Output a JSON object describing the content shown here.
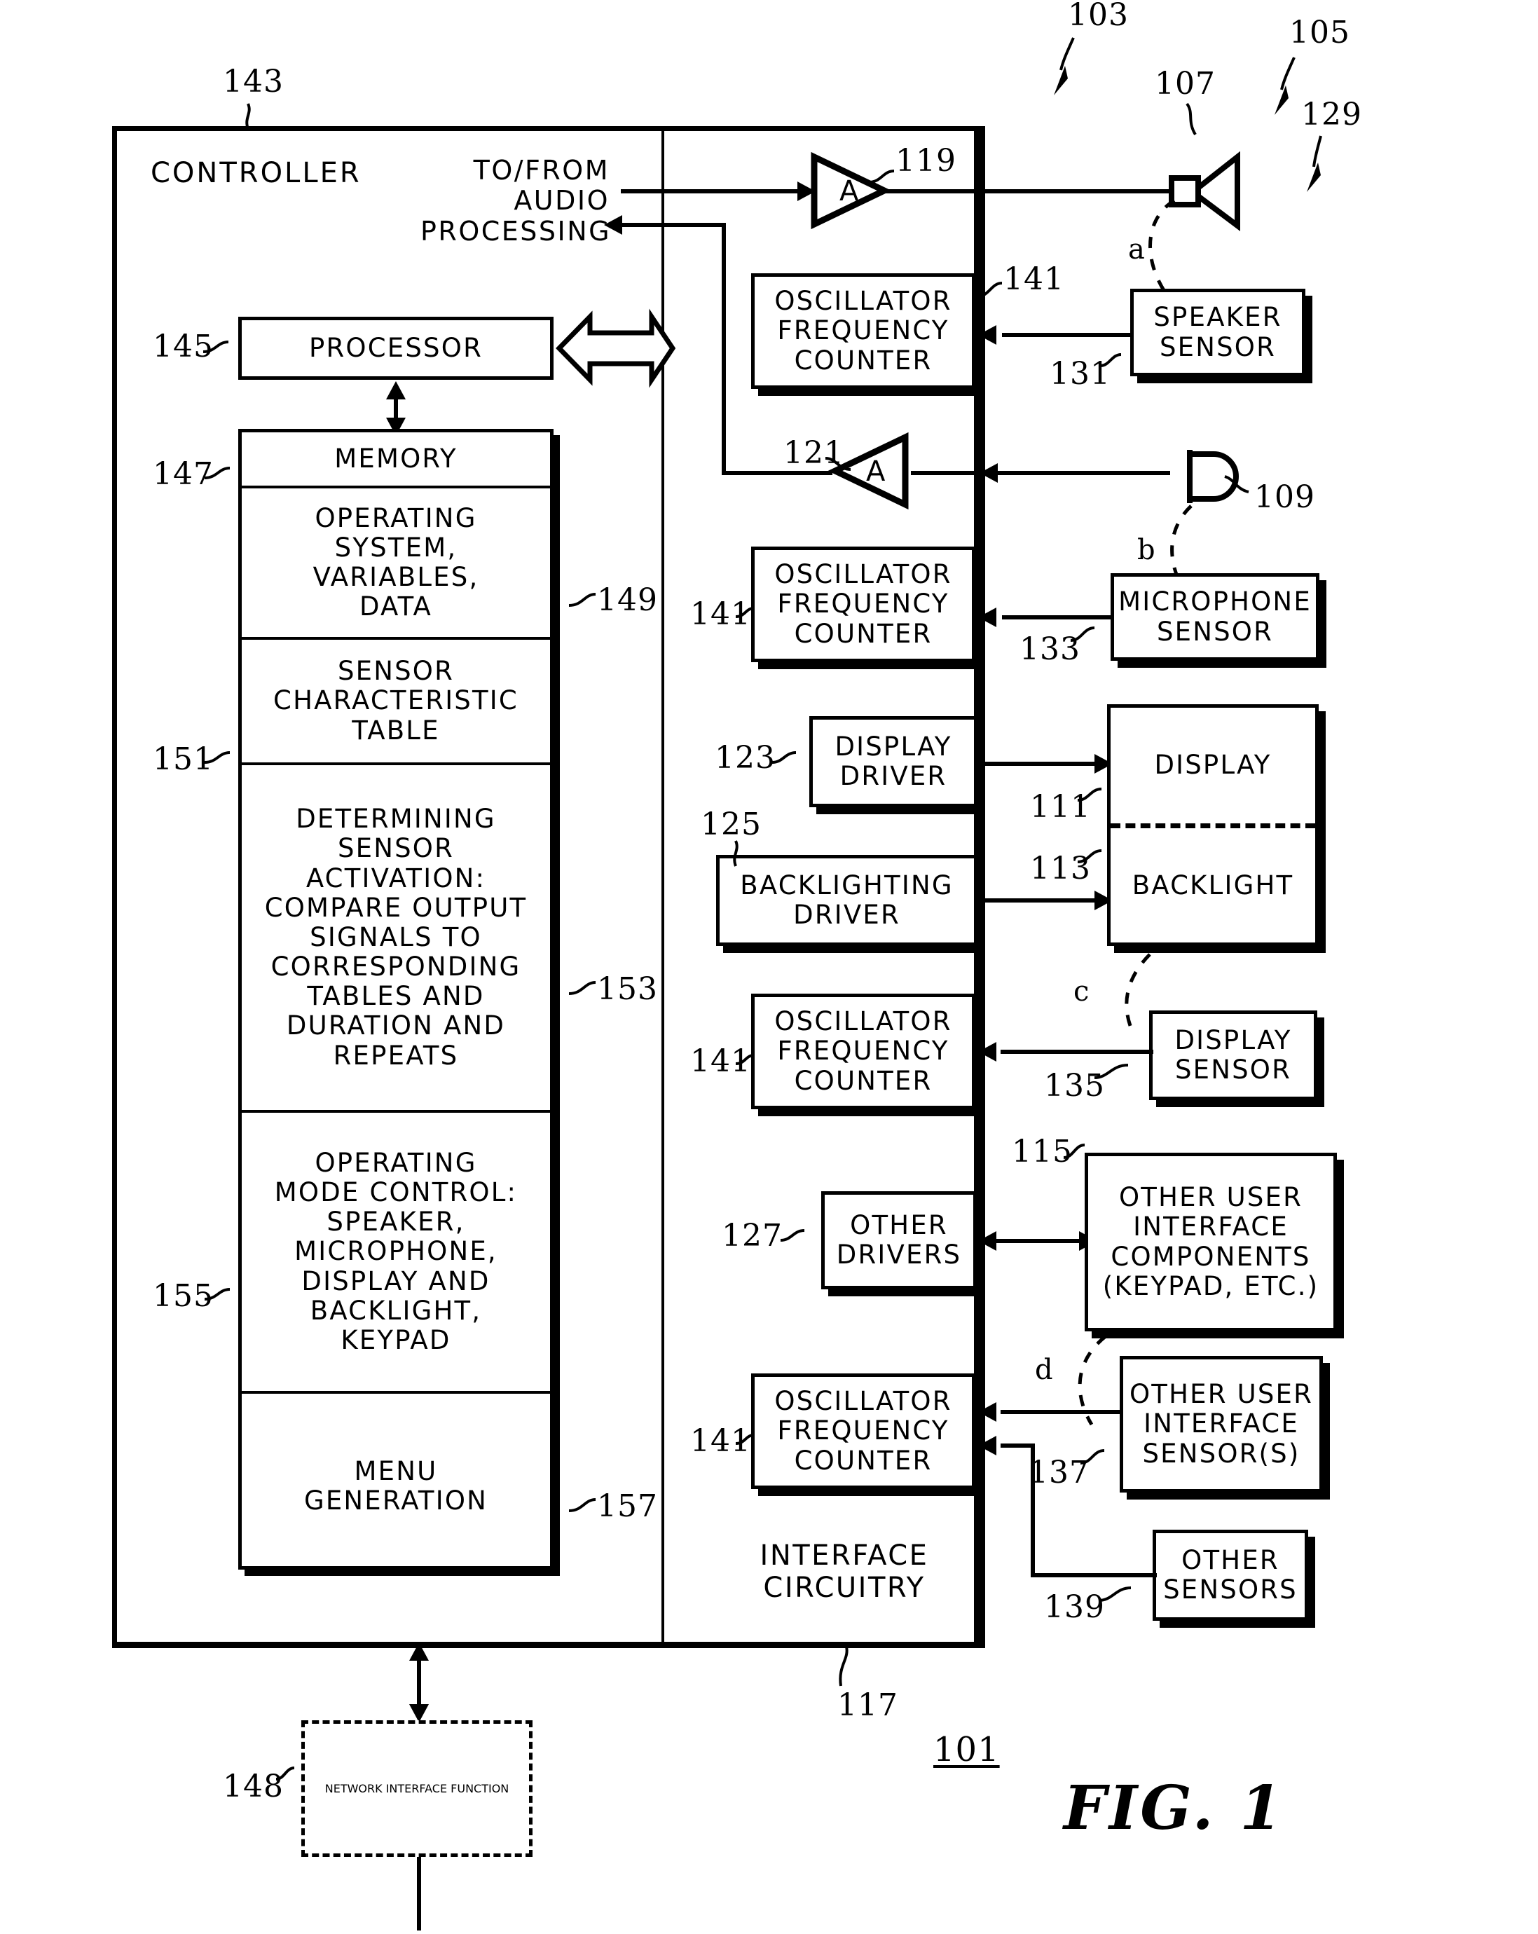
{
  "figure": {
    "title": "FIG. 1",
    "system_ref": "101"
  },
  "controller": {
    "title": "CONTROLLER",
    "ref": "143",
    "audio_label": "TO/FROM\nAUDIO\nPROCESSING",
    "processor": {
      "label": "PROCESSOR",
      "ref": "145"
    },
    "memory": {
      "title": "MEMORY",
      "ref": "147",
      "sections": [
        {
          "label": "OPERATING\nSYSTEM,\nVARIABLES,\nDATA",
          "ref": "149"
        },
        {
          "label": "SENSOR\nCHARACTERISTIC\nTABLE",
          "ref": "151"
        },
        {
          "label": "DETERMINING\nSENSOR\nACTIVATION:\nCOMPARE  OUTPUT\nSIGNALS  TO\nCORRESPONDING\nTABLES  AND\nDURATION  AND\nREPEATS",
          "ref": "153"
        },
        {
          "label": "OPERATING\nMODE CONTROL:\nSPEAKER,\nMICROPHONE,\nDISPLAY  AND\nBACKLIGHT,\nKEYPAD",
          "ref": "155"
        },
        {
          "label": "MENU\nGENERATION",
          "ref": "157"
        }
      ]
    }
  },
  "interface_circuitry": {
    "title": "INTERFACE\nCIRCUITRY",
    "ref": "117",
    "amplifiers": [
      {
        "label": "A",
        "ref": "119",
        "name": "speaker-amplifier"
      },
      {
        "label": "A",
        "ref": "121",
        "name": "microphone-amplifier"
      }
    ],
    "counters": [
      {
        "label": "OSCILLATOR\nFREQUENCY\nCOUNTER",
        "ref": "141"
      },
      {
        "label": "OSCILLATOR\nFREQUENCY\nCOUNTER",
        "ref": "141"
      },
      {
        "label": "OSCILLATOR\nFREQUENCY\nCOUNTER",
        "ref": "141"
      },
      {
        "label": "OSCILLATOR\nFREQUENCY\nCOUNTER",
        "ref": "141"
      }
    ],
    "drivers": [
      {
        "label": "DISPLAY\nDRIVER",
        "ref": "123"
      },
      {
        "label": "BACKLIGHTING\nDRIVER",
        "ref": "125"
      },
      {
        "label": "OTHER\nDRIVERS",
        "ref": "127"
      }
    ]
  },
  "user_interface": {
    "group_ref": "105",
    "device_ref": "103",
    "sensors_group_ref": "129",
    "speaker": {
      "ref": "107",
      "name": "speaker-transducer"
    },
    "microphone": {
      "ref": "109",
      "name": "microphone-transducer"
    },
    "display": {
      "label": "DISPLAY",
      "ref": "111"
    },
    "backlight": {
      "label": "BACKLIGHT",
      "ref": "113"
    },
    "other_components": {
      "label": "OTHER USER\nINTERFACE\nCOMPONENTS\n(KEYPAD, ETC.)",
      "ref": "115"
    }
  },
  "sensors": [
    {
      "label": "SPEAKER\nSENSOR",
      "ref": "131",
      "coupling": "a"
    },
    {
      "label": "MICROPHONE\nSENSOR",
      "ref": "133",
      "coupling": "b"
    },
    {
      "label": "DISPLAY\nSENSOR",
      "ref": "135",
      "coupling": "c"
    },
    {
      "label": "OTHER USER\nINTERFACE\nSENSOR(S)",
      "ref": "137",
      "coupling": "d"
    },
    {
      "label": "OTHER\nSENSORS",
      "ref": "139",
      "coupling": ""
    }
  ],
  "network_interface": {
    "label": "NETWORK\nINTERFACE\nFUNCTION",
    "ref": "148"
  },
  "couplings": {
    "a": "a",
    "b": "b",
    "c": "c",
    "d": "d"
  },
  "colors": {
    "ink": "#000000",
    "paper": "#ffffff"
  }
}
